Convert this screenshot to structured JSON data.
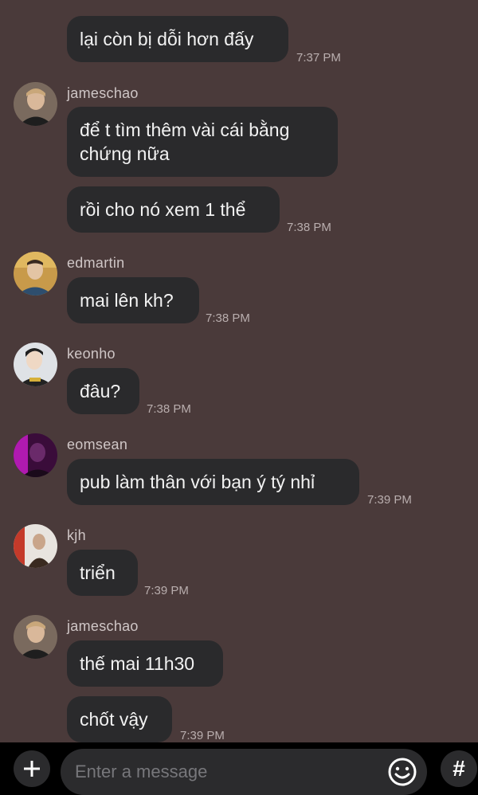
{
  "messages": [
    {
      "user": "",
      "bubbles": [
        "lại còn bị dỗi hơn đấy"
      ],
      "time": "7:37 PM"
    },
    {
      "user": "jameschao",
      "bubbles": [
        "để t tìm thêm vài cái bằng chứng nữa",
        "rồi cho nó xem 1 thể"
      ],
      "time": "7:38 PM"
    },
    {
      "user": "edmartin",
      "bubbles": [
        "mai lên kh?"
      ],
      "time": "7:38 PM"
    },
    {
      "user": "keonho",
      "bubbles": [
        "đâu?"
      ],
      "time": "7:38 PM"
    },
    {
      "user": "eomsean",
      "bubbles": [
        "pub làm thân với bạn ý tý nhỉ"
      ],
      "time": "7:39 PM"
    },
    {
      "user": "kjh",
      "bubbles": [
        "triển"
      ],
      "time": "7:39 PM"
    },
    {
      "user": "jameschao",
      "bubbles": [
        "thế mai 11h30",
        "chốt vậy"
      ],
      "time": "7:39 PM"
    }
  ],
  "composer": {
    "placeholder": "Enter a message",
    "plus_icon": "plus-icon",
    "emoji_icon": "smiley-icon",
    "hash_label": "#"
  },
  "colors": {
    "background": "#4a3a3a",
    "bubble": "#2a2a2c",
    "composer_bar": "#000000"
  }
}
